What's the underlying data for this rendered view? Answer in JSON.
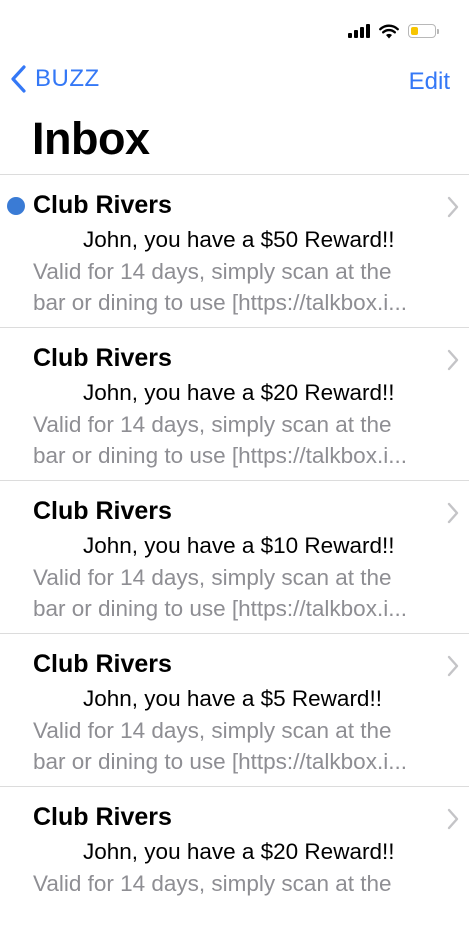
{
  "status_bar": {
    "signal_icon": "cellular-signal-icon",
    "wifi_icon": "wifi-icon",
    "battery_icon": "battery-low-icon",
    "battery_color": "#f7c500"
  },
  "nav": {
    "back_label": "BUZZ",
    "edit_label": "Edit",
    "accent_color": "#3478f6"
  },
  "page_title": "Inbox",
  "messages": [
    {
      "sender": "Club Rivers",
      "subject": "        John, you have a $50 Reward!!",
      "preview_line1": "Valid for 14 days, simply scan at the",
      "preview_line2": "bar or dining to use [https://talkbox.i...",
      "unread": true
    },
    {
      "sender": "Club Rivers",
      "subject": "        John, you have a $20 Reward!!",
      "preview_line1": "Valid for 14 days, simply scan at the",
      "preview_line2": "bar or dining to use [https://talkbox.i...",
      "unread": false
    },
    {
      "sender": "Club Rivers",
      "subject": "        John, you have a $10 Reward!!",
      "preview_line1": "Valid for 14 days, simply scan at the",
      "preview_line2": "bar or dining to use [https://talkbox.i...",
      "unread": false
    },
    {
      "sender": "Club Rivers",
      "subject": "        John, you have a $5 Reward!!",
      "preview_line1": "Valid for 14 days, simply scan at the",
      "preview_line2": "bar or dining to use [https://talkbox.i...",
      "unread": false
    },
    {
      "sender": "Club Rivers",
      "subject": "        John, you have a $20 Reward!!",
      "preview_line1": "Valid for 14 days, simply scan at the",
      "preview_line2": "",
      "unread": false
    }
  ]
}
